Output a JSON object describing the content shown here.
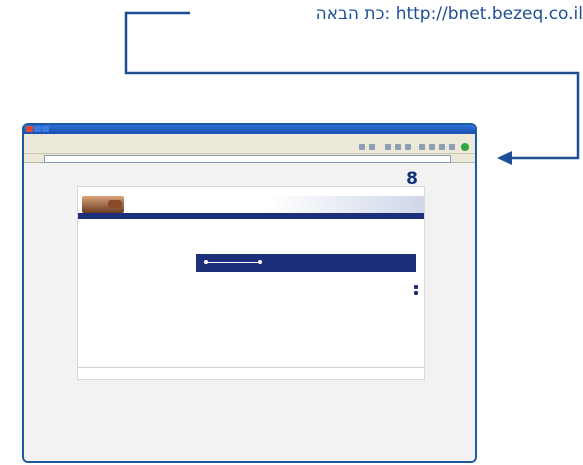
{
  "caption": {
    "label": "כת הבאה:",
    "url": "http://bnet.bezeq.co.il"
  },
  "colors": {
    "guide_line": "#1d4f95",
    "frame": "#1e5aa0",
    "brand_blue": "#13327a",
    "strip_blue": "#1e2f7a"
  },
  "icons": [
    "back-icon",
    "window-close-icon",
    "arrow-pointer-icon"
  ]
}
